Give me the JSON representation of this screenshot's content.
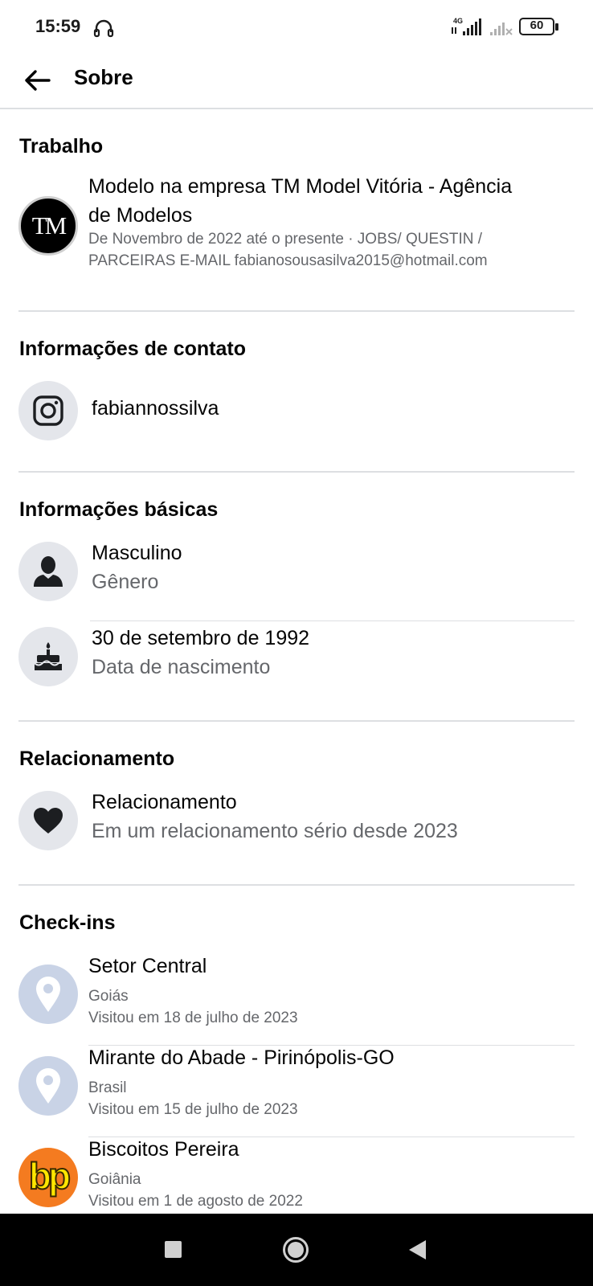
{
  "status_bar": {
    "time": "15:59",
    "network": "4G",
    "battery": "60"
  },
  "header": {
    "title": "Sobre"
  },
  "work": {
    "title": "Trabalho",
    "logo_text": "TM",
    "line1": "Modelo na empresa TM Model Vitória - Agência",
    "line2": "de Modelos",
    "detail1": "De Novembro de 2022 até o presente  ·  JOBS/ QUESTIN   /",
    "detail2": "PARCEIRAS  E-MAIL fabianosousasilva2015@hotmail.com"
  },
  "contact": {
    "title": "Informações de contato",
    "instagram": "fabiannossilva",
    "icon": "instagram-icon"
  },
  "basic": {
    "title": "Informações básicas",
    "gender_value": "Masculino",
    "gender_label": "Gênero",
    "birthday_value": "30 de setembro de 1992",
    "birthday_label": "Data de nascimento"
  },
  "relationship": {
    "title": "Relacionamento",
    "label": "Relacionamento",
    "value": "Em um relacionamento sério desde 2023"
  },
  "checkins": {
    "title": "Check-ins",
    "items": [
      {
        "name": "Setor Central",
        "region": "Goiás",
        "visited": "Visitou em 18 de julho de 2023"
      },
      {
        "name": "Mirante do Abade - Pirinópolis-GO",
        "region": "Brasil",
        "visited": "Visitou em 15 de julho de 2023"
      },
      {
        "name": "Biscoitos Pereira",
        "region": "Goiânia",
        "visited": "Visitou em 1 de agosto de 2022"
      }
    ],
    "logo_text": "bp"
  },
  "colors": {
    "secondary_text": "#65676b",
    "icon_bg": "#e4e6eb",
    "pin_bg": "#c9d3e6",
    "bp_orange": "#f47b20",
    "bp_yellow": "#ffe600"
  }
}
